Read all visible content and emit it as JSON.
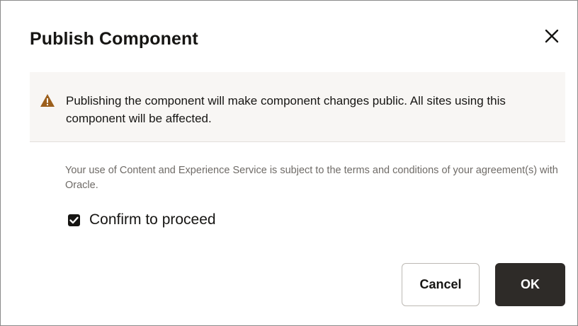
{
  "dialog": {
    "title": "Publish Component",
    "close_icon": "close-icon",
    "warning": {
      "icon": "warning-triangle-icon",
      "icon_color": "#9c5f1c",
      "text": "Publishing the component will make component changes public. All sites using this component will be affected."
    },
    "terms_text": "Your use of Content and Experience Service is subject to the terms and conditions of your agreement(s) with Oracle.",
    "confirm": {
      "label": "Confirm to proceed",
      "checked": true
    },
    "buttons": {
      "cancel_label": "Cancel",
      "ok_label": "OK"
    }
  }
}
